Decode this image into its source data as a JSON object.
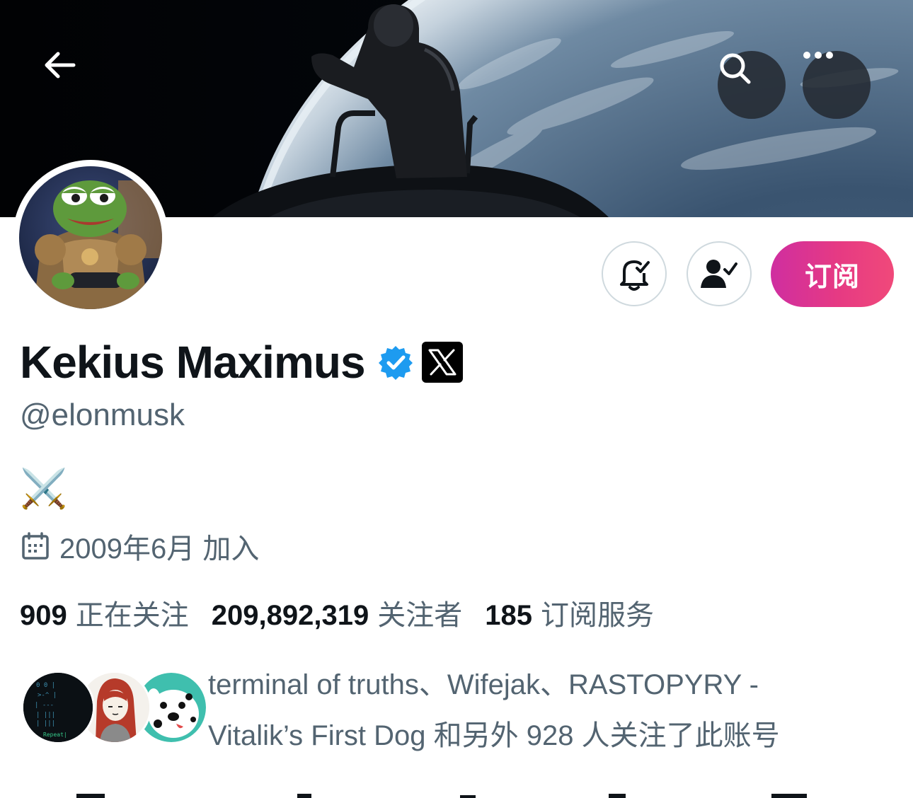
{
  "header": {
    "back_icon": "arrow-left-icon",
    "search_icon": "search-icon",
    "more_icon": "more-horizontal-icon"
  },
  "profile": {
    "display_name": "Kekius Maximus",
    "verified_icon": "verified-badge-icon",
    "affiliation_icon": "x-logo-icon",
    "handle": "@elonmusk",
    "bio": "⚔️",
    "joined": "2009年6月 加入"
  },
  "actions": {
    "notifications_icon": "bell-check-icon",
    "following_icon": "person-check-icon",
    "subscribe_label": "订阅"
  },
  "stats": [
    {
      "count": "909",
      "label": "正在关注"
    },
    {
      "count": "209,892,319",
      "label": "关注者"
    },
    {
      "count": "185",
      "label": "订阅服务"
    }
  ],
  "followers_you_know": {
    "line1": "terminal of truths、Wifejak、RASTOPYRY -",
    "line2": "Vitalik’s First Dog 和另外 928 人关注了此账号",
    "avatar_1_text": "Repeat|"
  },
  "colors": {
    "accent_blue": "#1d9bf0",
    "subscribe_gradient_start": "#cf2ea0",
    "subscribe_gradient_end": "#f0497a",
    "text_primary": "#0f1419",
    "text_secondary": "#536471"
  }
}
